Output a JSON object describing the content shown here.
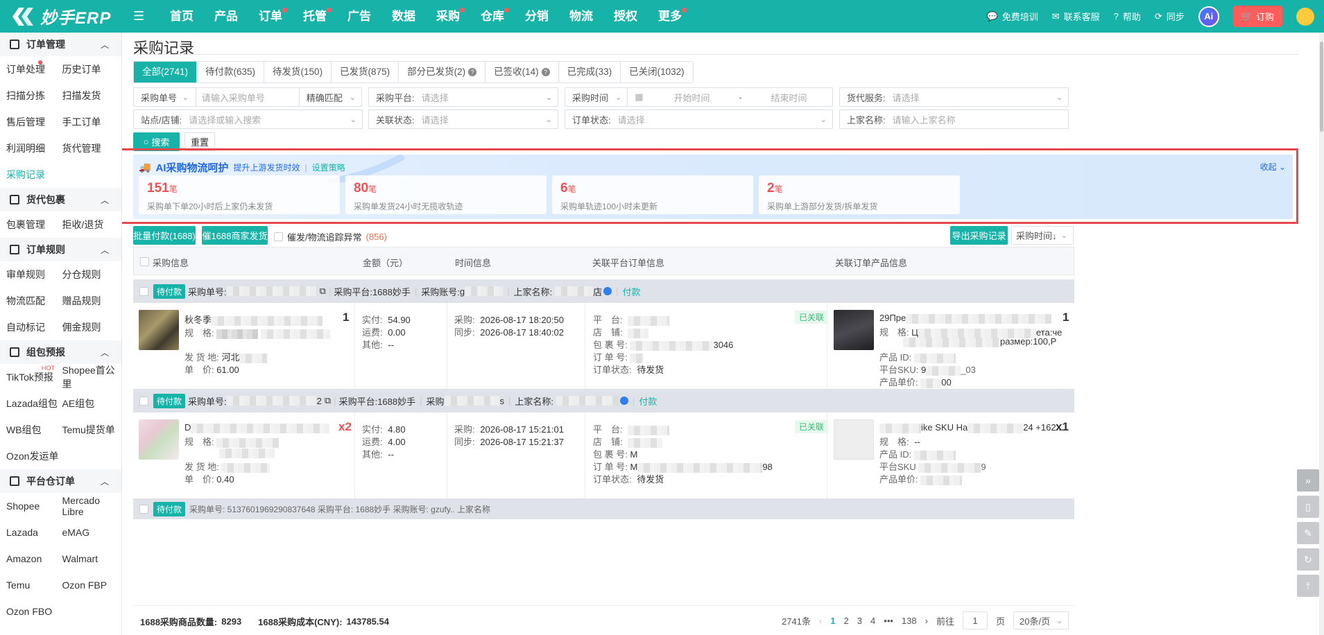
{
  "app": {
    "logo_text": "妙手ERP"
  },
  "nav": [
    {
      "label": "首页",
      "dot": false
    },
    {
      "label": "产品",
      "dot": false
    },
    {
      "label": "订单",
      "dot": true
    },
    {
      "label": "托管",
      "dot": true
    },
    {
      "label": "广告",
      "dot": false
    },
    {
      "label": "数据",
      "dot": false
    },
    {
      "label": "采购",
      "dot": true
    },
    {
      "label": "仓库",
      "dot": true
    },
    {
      "label": "分销",
      "dot": false
    },
    {
      "label": "物流",
      "dot": false
    },
    {
      "label": "授权",
      "dot": false
    },
    {
      "label": "更多",
      "dot": true
    }
  ],
  "top_right": {
    "training": "免费培训",
    "service": "联系客服",
    "help": "帮助",
    "sync": "同步",
    "ai": "Ai",
    "order": "订购"
  },
  "sidebar": {
    "groups": [
      {
        "title": "订单管理",
        "rows": [
          [
            "订单处理",
            "历史订单"
          ],
          [
            "扫描分拣",
            "扫描发货"
          ],
          [
            "售后管理",
            "手工订单"
          ],
          [
            "利润明细",
            "货代管理"
          ],
          [
            "采购记录"
          ]
        ]
      },
      {
        "title": "货代包裹",
        "rows": [
          [
            "包裹管理",
            "拒收/退货"
          ]
        ]
      },
      {
        "title": "订单规则",
        "rows": [
          [
            "审单规则",
            "分仓规则"
          ],
          [
            "物流匹配",
            "赠品规则"
          ],
          [
            "自动标记",
            "佣金规则"
          ]
        ]
      },
      {
        "title": "组包预报",
        "rows": [
          [
            "TikTok预报",
            "Shopee首公里"
          ],
          [
            "Lazada组包",
            "AE组包"
          ],
          [
            "WB组包",
            "Temu提货单"
          ],
          [
            "Ozon发运单"
          ]
        ]
      },
      {
        "title": "平台仓订单",
        "rows": [
          [
            "Shopee",
            "Mercado Libre"
          ],
          [
            "Lazada",
            "eMAG"
          ],
          [
            "Amazon",
            "Walmart"
          ],
          [
            "Temu",
            "Ozon FBP"
          ],
          [
            "Ozon FBO"
          ]
        ]
      }
    ],
    "active": "采购记录",
    "hot_tag": "HOT"
  },
  "page": {
    "title": "采购记录"
  },
  "tabs": [
    {
      "label": "全部(2741)",
      "active": true,
      "help": false
    },
    {
      "label": "待付款(635)",
      "active": false,
      "help": false
    },
    {
      "label": "待发货(150)",
      "active": false,
      "help": false
    },
    {
      "label": "已发货(875)",
      "active": false,
      "help": false
    },
    {
      "label": "部分已发货(2)",
      "active": false,
      "help": true
    },
    {
      "label": "已签收(14)",
      "active": false,
      "help": true
    },
    {
      "label": "已完成(33)",
      "active": false,
      "help": false
    },
    {
      "label": "已关闭(1032)",
      "active": false,
      "help": false
    }
  ],
  "filters": {
    "order_no_type": "采购单号",
    "order_no_ph": "请输入采购单号",
    "match": "精确匹配",
    "platform_label": "采购平台:",
    "platform_ph": "请选择",
    "time_type": "采购时间",
    "start_ph": "开始时间",
    "range_sep": "-",
    "end_ph": "结束时间",
    "agent_label": "货代服务:",
    "agent_ph": "请选择",
    "shop_label": "站点/店铺:",
    "shop_ph": "请选择或输入搜索",
    "link_label": "关联状态:",
    "link_ph": "请选择",
    "order_status_label": "订单状态:",
    "order_status_ph": "请选择",
    "supplier_label": "上家名称:",
    "supplier_ph": "请输入上家名称",
    "search": "搜索",
    "reset": "重置"
  },
  "ai_panel": {
    "title": "AI采购物流呵护",
    "link1": "提升上游发货时效",
    "sep": "|",
    "link2": "设置策略",
    "collapse": "收起",
    "unit": "笔",
    "stats": [
      {
        "num": "151",
        "desc": "采购单下单20小时后上家仍未发货"
      },
      {
        "num": "80",
        "desc": "采购单发货24小时无揽收轨迹"
      },
      {
        "num": "6",
        "desc": "采购单轨迹100小时未更新"
      },
      {
        "num": "2",
        "desc": "采购单上游部分发货/拆单发货"
      }
    ]
  },
  "actions": {
    "batch_pay": "批量付款(1688)",
    "urge_ship": "催1688商家发货",
    "abnormal_label": "催发/物流追踪异常",
    "abnormal_count": "(856)",
    "export": "导出采购记录",
    "sort": "采购时间↓"
  },
  "table": {
    "headers": [
      "采购信息",
      "金额（元）",
      "时间信息",
      "关联平台订单信息",
      "关联订单产品信息"
    ]
  },
  "orders": [
    {
      "status": "待付款",
      "order_no_label": "采购单号:",
      "platform_label": "采购平台:",
      "platform": "1688妙手",
      "account_label": "采购账号:",
      "account_prefix": "g",
      "supplier_label": "上家名称:",
      "supplier_suffix": "店",
      "pay": "付款",
      "title_prefix": "秋冬季",
      "qty": "1",
      "spec_label": "规　格:",
      "origin_label": "发 货 地:",
      "origin": "河北",
      "price_label": "单　价:",
      "price": "61.00",
      "paid_label": "实付:",
      "paid": "54.90",
      "freight_label": "运费:",
      "freight": "0.00",
      "other_label": "其他:",
      "other": "--",
      "purchase_time_label": "采购:",
      "purchase_time": "2026-08-17 18:20:50",
      "sync_time_label": "同步:",
      "sync_time": "2026-08-17 18:40:02",
      "plat_label": "平　台:",
      "shop_label": "店　铺:",
      "pkg_label": "包 裹 号:",
      "pkg_suffix": "3046",
      "ord_label": "订 单 号:",
      "ostatus_label": "订单状态:",
      "ostatus": "待发货",
      "linked": "已关联",
      "prod_title": "29Пре",
      "prod_qty": "1",
      "prod_spec_label": "规　格:",
      "prod_spec": "Ц",
      "prod_spec_tail": "ета:че",
      "prod_spec_tail2": "размер:100,Р",
      "prod_id_label": "产品 ID:",
      "sku_label": "平台SKU:",
      "sku_prefix": "9",
      "sku_suffix": "_03",
      "unit_price_label": "产品单价:",
      "unit_price_suffix": "00"
    },
    {
      "status": "待付款",
      "order_no_label": "采购单号:",
      "order_no_suffix": "2",
      "platform_label": "采购平台:",
      "platform": "1688妙手",
      "account_label": "采购",
      "account_suffix": "s",
      "supplier_label": "上家名称:",
      "pay": "付款",
      "title_prefix": "D",
      "qty": "x2",
      "spec_label": "规　格:",
      "origin_label": "发 货 地:",
      "price_label": "单　价:",
      "price": "0.40",
      "paid_label": "实付:",
      "paid": "4.80",
      "freight_label": "运费:",
      "freight": "4.00",
      "other_label": "其他:",
      "other": "--",
      "purchase_time_label": "采购:",
      "purchase_time": "2026-08-17 15:21:01",
      "sync_time_label": "同步:",
      "sync_time": "2026-08-17 15:21:37",
      "plat_label": "平　台:",
      "shop_label": "店　铺:",
      "pkg_label": "包 裹 号:",
      "pkg_prefix": "M",
      "ord_label": "订 单 号:",
      "ord_prefix": "M",
      "ord_suffix": "98",
      "ostatus_label": "订单状态:",
      "ostatus": "待发货",
      "linked": "已关联",
      "prod_title_mid": "ike SKU На",
      "prod_title_tail": "24 +162...",
      "prod_qty": "x1",
      "prod_spec_label": "规　格:",
      "prod_spec": "--",
      "prod_id_label": "产品 ID:",
      "sku_label": "平台SKU",
      "sku_suffix": "9",
      "unit_price_label": "产品单价:"
    }
  ],
  "third_row_peek": "采购单号: 5137601969290837648  采购平台: 1688妙手  采购账号: gzufy..  上家名称",
  "footer": {
    "count_label": "1688采购商品数量:",
    "count": "8293",
    "cost_label": "1688采购成本(CNY):",
    "cost": "143785.54",
    "total": "2741条",
    "pages": [
      "1",
      "2",
      "3",
      "4",
      "•••",
      "138"
    ],
    "goto": "前往",
    "goto_val": "1",
    "page_unit": "页",
    "per_page": "20条/页"
  }
}
